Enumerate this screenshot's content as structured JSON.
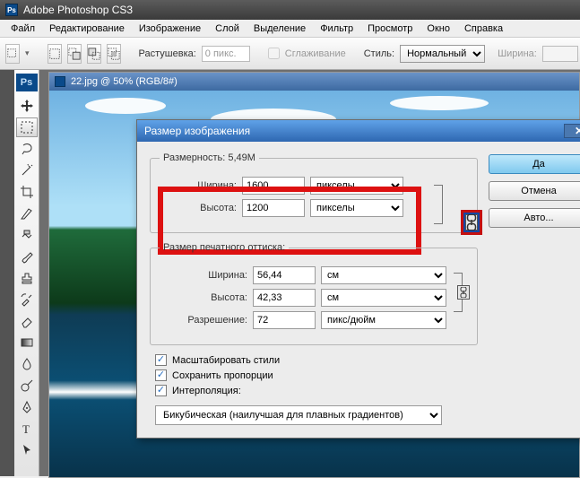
{
  "app": {
    "title": "Adobe Photoshop CS3"
  },
  "menu": [
    "Файл",
    "Редактирование",
    "Изображение",
    "Слой",
    "Выделение",
    "Фильтр",
    "Просмотр",
    "Окно",
    "Справка"
  ],
  "options": {
    "feather_label": "Растушевка:",
    "feather_value": "0 пикс.",
    "antialias_label": "Сглаживание",
    "style_label": "Стиль:",
    "style_value": "Нормальный",
    "width_label": "Ширина:"
  },
  "document": {
    "title": "22.jpg @ 50% (RGB/8#)"
  },
  "dialog": {
    "title": "Размер изображения",
    "pixel_dim": {
      "legend": "Размерность:  5,49M",
      "width_label": "Ширина:",
      "width_value": "1600",
      "height_label": "Высота:",
      "height_value": "1200",
      "unit": "пикселы"
    },
    "doc_size": {
      "legend": "Размер печатного оттиска:",
      "width_label": "Ширина:",
      "width_value": "56,44",
      "height_label": "Высота:",
      "height_value": "42,33",
      "unit": "см",
      "res_label": "Разрешение:",
      "res_value": "72",
      "res_unit": "пикс/дюйм"
    },
    "scale_styles": "Масштабировать стили",
    "constrain": "Сохранить пропорции",
    "resample": "Интерполяция:",
    "interp_value": "Бикубическая (наилучшая для плавных градиентов)",
    "buttons": {
      "ok": "Да",
      "cancel": "Отмена",
      "auto": "Авто..."
    }
  }
}
